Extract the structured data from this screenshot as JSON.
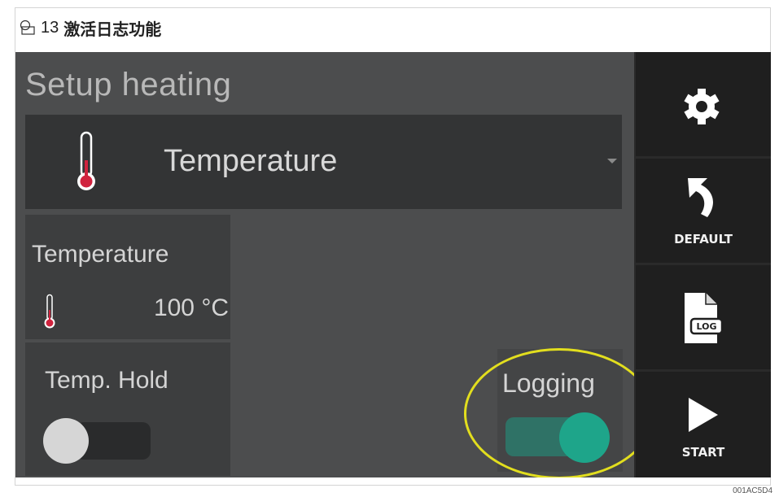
{
  "caption": {
    "figure_number": "13",
    "title": "激活日志功能"
  },
  "screen": {
    "heading": "Setup heating",
    "parameter_select": {
      "selected": "Temperature",
      "icon": "thermometer-icon"
    },
    "temperature_card": {
      "title": "Temperature",
      "value": "100 °C",
      "icon": "thermometer-icon"
    },
    "temp_hold_card": {
      "title": "Temp. Hold",
      "toggle_state": "off"
    },
    "logging_card": {
      "title": "Logging",
      "toggle_state": "on",
      "highlighted": true
    }
  },
  "sidebar": {
    "settings": {
      "icon": "gear-icon"
    },
    "default": {
      "label": "DEFAULT",
      "icon": "return-arrow-icon"
    },
    "log": {
      "icon_text": "LOG",
      "icon": "log-file-icon"
    },
    "start": {
      "label": "START",
      "icon": "play-icon"
    }
  },
  "document_id": "001AC5D4",
  "colors": {
    "accent_teal": "#1ea58a",
    "highlight_yellow": "#e2de1e",
    "thermometer_red": "#d0233e",
    "panel_dark": "#333435"
  }
}
